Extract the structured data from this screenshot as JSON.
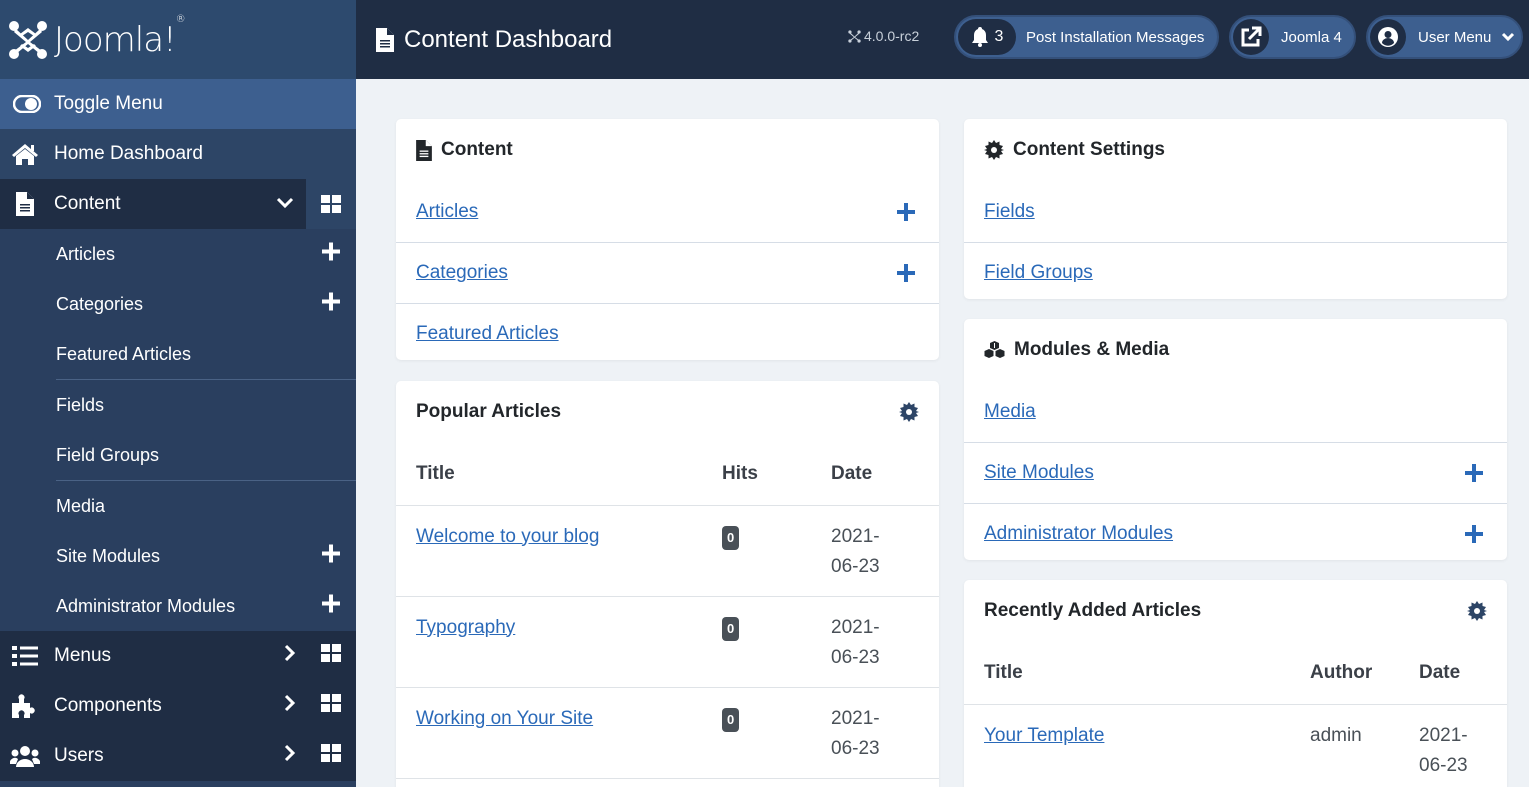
{
  "app": {
    "logo_text": "Joomla!",
    "logo_reg": "®"
  },
  "header": {
    "title": "Content Dashboard",
    "title_icon": "file-icon",
    "version": "4.0.0-rc2",
    "post_install": {
      "count": "3",
      "label": "Post Installation Messages",
      "icon": "bell-icon"
    },
    "site_link": {
      "label": "Joomla 4",
      "icon": "external-link-icon"
    },
    "user_menu": {
      "label": "User Menu",
      "icon": "user-circle-icon"
    }
  },
  "sidebar": {
    "toggle": {
      "label": "Toggle Menu",
      "icon": "toggle-icon"
    },
    "home": {
      "label": "Home Dashboard",
      "icon": "home-icon"
    },
    "content": {
      "label": "Content",
      "icon": "file-icon",
      "expanded": true,
      "items": [
        {
          "label": "Articles",
          "add": true
        },
        {
          "label": "Categories",
          "add": true
        },
        {
          "label": "Featured Articles",
          "add": false
        },
        {
          "label": "Fields",
          "add": false
        },
        {
          "label": "Field Groups",
          "add": false
        },
        {
          "label": "Media",
          "add": false
        },
        {
          "label": "Site Modules",
          "add": true
        },
        {
          "label": "Administrator Modules",
          "add": true
        }
      ]
    },
    "menus": {
      "label": "Menus",
      "icon": "list-icon"
    },
    "components": {
      "label": "Components",
      "icon": "puzzle-icon"
    },
    "users": {
      "label": "Users",
      "icon": "users-icon"
    }
  },
  "cards": {
    "content": {
      "title": "Content",
      "links": [
        {
          "label": "Articles",
          "add": true
        },
        {
          "label": "Categories",
          "add": true
        },
        {
          "label": "Featured Articles",
          "add": false
        }
      ]
    },
    "content_settings": {
      "title": "Content Settings",
      "links": [
        {
          "label": "Fields"
        },
        {
          "label": "Field Groups"
        }
      ]
    },
    "modules_media": {
      "title": "Modules & Media",
      "links": [
        {
          "label": "Media",
          "add": false
        },
        {
          "label": "Site Modules",
          "add": true
        },
        {
          "label": "Administrator Modules",
          "add": true
        }
      ]
    },
    "popular": {
      "title": "Popular Articles",
      "columns": [
        "Title",
        "Hits",
        "Date"
      ],
      "rows": [
        {
          "title": "Welcome to your blog",
          "hits": "0",
          "date1": "2021-",
          "date2": "06-23"
        },
        {
          "title": "Typography",
          "hits": "0",
          "date1": "2021-",
          "date2": "06-23"
        },
        {
          "title": "Working on Your Site",
          "hits": "0",
          "date1": "2021-",
          "date2": "06-23"
        }
      ]
    },
    "recent": {
      "title": "Recently Added Articles",
      "columns": [
        "Title",
        "Author",
        "Date"
      ],
      "rows": [
        {
          "title": "Your Template",
          "author": "admin",
          "date1": "2021-",
          "date2": "06-23"
        }
      ]
    }
  },
  "colors": {
    "sidebar": "#2a3f5f",
    "header": "#1f2d44",
    "accent": "#3d5f8f",
    "link": "#2a69b8",
    "background": "#eef2f6"
  }
}
